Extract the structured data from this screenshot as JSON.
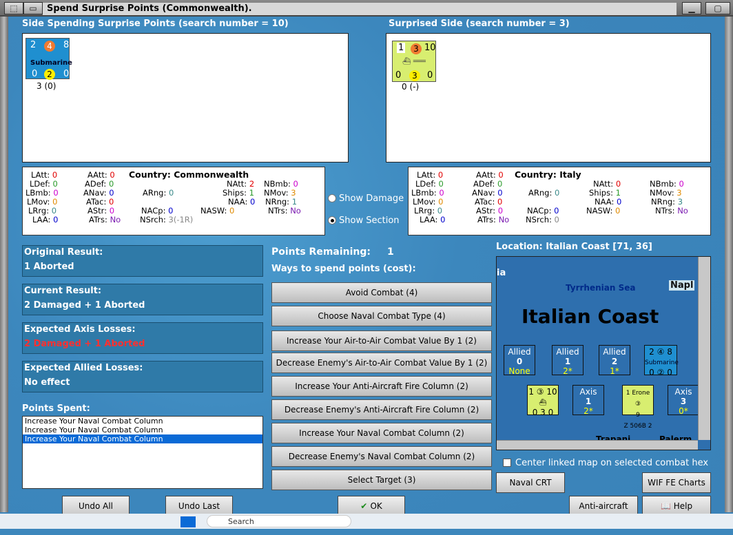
{
  "window": {
    "title": "Spend Surprise Points (Commonwealth)."
  },
  "left_side": {
    "header": "Side Spending Surprise Points (search number = 10)",
    "unit": {
      "top_left": "2",
      "circle_top": "4",
      "top_right": "8",
      "name": "Submarine",
      "bottom_left": "0",
      "circle_bottom": "2",
      "bottom_right": "0",
      "caption": "3 (0)"
    }
  },
  "right_side": {
    "header": "Surprised Side (search number = 3)",
    "unit": {
      "top_left": "1",
      "circle_top": "3",
      "top_right": "10",
      "bottom_left": "0",
      "circle_bottom": "3",
      "bottom_right": "0",
      "caption": "0 (-)"
    }
  },
  "stats_left": {
    "country_label": "Country: Commonwealth",
    "LAtt": "0",
    "AAtt": "0",
    "NAtt": "2",
    "NBmb": "0",
    "LDef": "0",
    "ADef": "0",
    "LBmb": "0",
    "ANav": "0",
    "ARng": "0",
    "Ships": "1",
    "NMov": "3",
    "LMov": "0",
    "ATac": "0",
    "NAA": "0",
    "NRng": "1",
    "LRrg": "0",
    "AStr": "0",
    "NACp": "0",
    "NASW": "0",
    "NTrs": "No",
    "LAA": "0",
    "ATrs": "No",
    "NSrch": "3(-1R)"
  },
  "stats_right": {
    "country_label": "Country: Italy",
    "LAtt": "0",
    "AAtt": "0",
    "NAtt": "0",
    "NBmb": "0",
    "LDef": "0",
    "ADef": "0",
    "LBmb": "0",
    "ANav": "0",
    "ARng": "0",
    "Ships": "1",
    "NMov": "3",
    "LMov": "0",
    "ATac": "0",
    "NAA": "0",
    "NRng": "3",
    "LRrg": "0",
    "AStr": "0",
    "NACp": "0",
    "NASW": "0",
    "NTrs": "No",
    "LAA": "0",
    "ATrs": "No",
    "NSrch": "0"
  },
  "labels": {
    "LAtt": "LAtt:",
    "AAtt": "AAtt:",
    "NAtt": "NAtt:",
    "NBmb": "NBmb:",
    "LDef": "LDef:",
    "ADef": "ADef:",
    "LBmb": "LBmb:",
    "ANav": "ANav:",
    "ARng": "ARng:",
    "Ships": "Ships:",
    "NMov": "NMov:",
    "LMov": "LMov:",
    "ATac": "ATac:",
    "NAA": "NAA:",
    "NRng": "NRng:",
    "LRrg": "LRrg:",
    "AStr": "AStr:",
    "NACp": "NACp:",
    "NASW": "NASW:",
    "NTrs": "NTrs:",
    "LAA": "LAA:",
    "ATrs": "ATrs:",
    "NSrch": "NSrch:"
  },
  "radios": {
    "show_damage": "Show Damage",
    "show_section": "Show Section",
    "selected": "show_section"
  },
  "results": {
    "original_label": "Original Result:",
    "original_value": "1 Aborted",
    "current_label": "Current Result:",
    "current_value": "2 Damaged + 1 Aborted",
    "axis_label": "Expected Axis Losses:",
    "axis_value": "2 Damaged + 1 Aborted",
    "allied_label": "Expected Allied Losses:",
    "allied_value": "No effect"
  },
  "points": {
    "remaining_label": "Points Remaining:",
    "remaining_value": "1",
    "ways_label": "Ways to spend points (cost):",
    "spent_label": "Points Spent:"
  },
  "options": [
    "Avoid Combat (4)",
    "Choose Naval Combat Type (4)",
    "Increase Your Air-to-Air Combat Value By 1 (2)",
    "Decrease Enemy's Air-to-Air Combat Value By 1 (2)",
    "Increase Your Anti-Aircraft Fire Column (2)",
    "Decrease Enemy's Anti-Aircraft Fire Column (2)",
    "Increase Your Naval Combat Column (2)",
    "Decrease Enemy's Naval Combat Column (2)",
    "Select Target (3)"
  ],
  "spent_list": [
    "Increase Your Naval Combat Column",
    "Increase Your Naval Combat Column",
    "Increase Your Naval Combat Column"
  ],
  "map": {
    "location": "Location: Italian Coast [71, 36]",
    "title": "Italian Coast",
    "sea": "Tyrrhenian Sea",
    "edge_left": "ia",
    "edge_right": "Napl",
    "bottom_left": "Trapani",
    "bottom_right": "Palerm",
    "allied": [
      {
        "label": "Allied",
        "num": "0",
        "sub": "None"
      },
      {
        "label": "Allied",
        "num": "1",
        "sub": "2*"
      },
      {
        "label": "Allied",
        "num": "2",
        "sub": "1*"
      }
    ],
    "axis": [
      {
        "label": "Axis",
        "num": "1",
        "sub": "2*"
      },
      {
        "label": "Axis",
        "num": "3",
        "sub": "0*"
      }
    ],
    "center_link": "Center linked map on selected combat hex"
  },
  "buttons": {
    "undo_all": "Undo All",
    "undo_last": "Undo Last",
    "ok": "OK",
    "naval_crt": "Naval CRT",
    "wif_fe": "WIF FE Charts",
    "aa_crt": "Anti-aircraft CRT",
    "help": "Help"
  },
  "taskbar": {
    "search": "Search"
  }
}
